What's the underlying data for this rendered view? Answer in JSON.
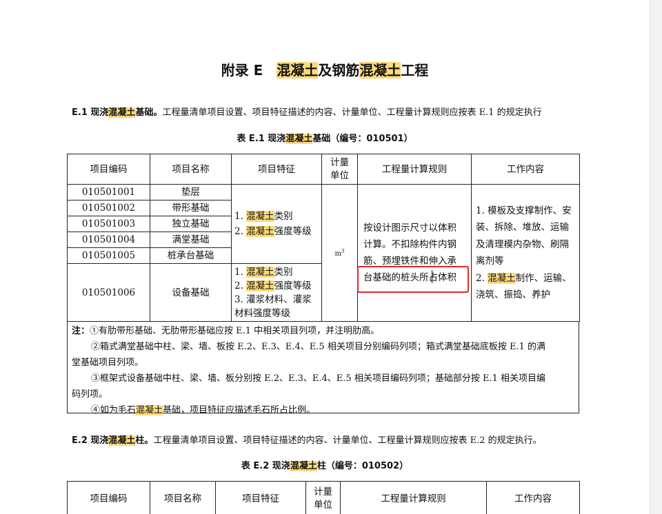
{
  "title": {
    "prefix": "附录 E　",
    "hl1": "混凝土",
    "mid": "及钢筋",
    "hl2": "混凝土",
    "suffix": "工程"
  },
  "e1": {
    "heading_num": "E.1 现浇",
    "heading_hl": "混凝土",
    "heading_rest": "基础",
    "heading_mark": "。",
    "desc": "工程量清单项目设置、项目特征描述的内容、计量单位、工程量计算规则应按表 E.1 的规定执行",
    "caption_pre": "表 E.1 现浇",
    "caption_hl": "混凝土",
    "caption_post": "基础（编号：010501）"
  },
  "table1": {
    "headers": [
      "项目编码",
      "项目名称",
      "项目特征",
      "计量单位",
      "工程量计算规则",
      "工作内容"
    ],
    "rows": [
      {
        "code": "010501001",
        "name": "垫层"
      },
      {
        "code": "010501002",
        "name": "带形基础"
      },
      {
        "code": "010501003",
        "name": "独立基础"
      },
      {
        "code": "010501004",
        "name": "满堂基础"
      },
      {
        "code": "010501005",
        "name": "桩承台基础"
      },
      {
        "code": "010501006",
        "name": "设备基础"
      }
    ],
    "feature_a": {
      "l1_pre": "1. ",
      "l1_hl": "混凝土",
      "l1_post": "类别",
      "l2_pre": "2. ",
      "l2_hl": "混凝土",
      "l2_post": "强度等级"
    },
    "feature_b": {
      "l1_pre": "1. ",
      "l1_hl": "混凝土",
      "l1_post": "类别",
      "l2_pre": "2. ",
      "l2_hl": "混凝土",
      "l2_post": "强度等级",
      "l3": "3. 灌浆材料、灌浆",
      "l4": "材料强度等级"
    },
    "unit": "m",
    "unit_sup": "3",
    "rule": [
      "按设计图示尺寸以体积",
      "计算。不扣除构件内钢",
      "筋、预埋铁件和伸入承",
      "台基础的桩头所占体积"
    ],
    "work": {
      "l1": "1. 模板及支撑制作、安",
      "l2": "装、拆除、堆放、运输",
      "l3": "及清理模内杂物、刷隔",
      "l4": "离剂等",
      "l5_pre": "2. ",
      "l5_hl": "混凝土",
      "l5_post": "制作、运输、",
      "l6": "浇筑、振捣、养护"
    }
  },
  "notes": {
    "label": "注：",
    "n1": "①有肋带形基础、无肋带形基础应按 E.1 中相关项目列项，并注明肋高。",
    "n2a": "②箱式满堂基础中柱、梁、墙、板按 E.2、E.3、E.4、E.5 相关项目分别编码列项；箱式满堂基础底板按 E.1 的满",
    "n2b": "堂基础项目列项。",
    "n3a": "③框架式设备基础中柱、梁、墙、板分别按 E.2、E.3、E.4、E.5 相关项目编码列项；基础部分按 E.1 相关项目编",
    "n3b": "码列项。",
    "n4_pre": "④如为毛石",
    "n4_hl": "混凝土",
    "n4_post": "基础，项目特征应描述毛石所占比例。"
  },
  "e2": {
    "heading_num": "E.2 现浇",
    "heading_hl": "混凝土",
    "heading_rest": "柱",
    "heading_mark": "。",
    "desc": "工程量清单项目设置、项目特征描述的内容、计量单位、工程量计算规则应按表 E.2 的规定执行。",
    "caption_pre": "表 E.2 现浇",
    "caption_hl": "混凝土",
    "caption_post": "柱（编号：010502）"
  },
  "table2": {
    "headers": [
      "项目编码",
      "项目名称",
      "项目特征",
      "计量单位",
      "工程量计算规则",
      "工作内容"
    ]
  }
}
